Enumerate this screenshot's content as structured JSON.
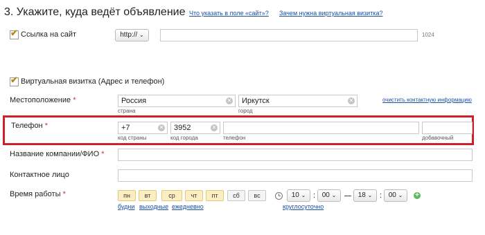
{
  "header": {
    "title": "3. Укажите, куда ведёт объявление",
    "help1": "Что указать в поле «сайт»?",
    "help2": "Зачем нужна виртуальная визитка?"
  },
  "site": {
    "label": "Ссылка на сайт",
    "protocol": "http://",
    "url_value": "",
    "counter": "1024"
  },
  "vcard": {
    "label": "Виртуальная визитка (Адрес и телефон)"
  },
  "location": {
    "label": "Местоположение",
    "country_value": "Россия",
    "country_hint": "страна",
    "city_value": "Иркутск",
    "city_hint": "город",
    "clear_link": "очистить контактную информацию"
  },
  "phone": {
    "label": "Телефон",
    "country_code": "+7",
    "country_code_hint": "код страны",
    "city_code": "3952",
    "city_code_hint": "код города",
    "number": "",
    "number_hint": "телефон",
    "ext": "",
    "ext_hint": "добавочный"
  },
  "company": {
    "label": "Название компании/ФИО",
    "value": ""
  },
  "contact": {
    "label": "Контактное лицо",
    "value": ""
  },
  "schedule": {
    "label": "Время работы",
    "days": [
      "пн",
      "вт",
      "ср",
      "чт",
      "пт",
      "сб",
      "вс"
    ],
    "days_selected": [
      true,
      true,
      true,
      true,
      true,
      false,
      false
    ],
    "links": [
      "будни",
      "выходные",
      "ежедневно"
    ],
    "from_hour": "10",
    "from_min": "00",
    "to_hour": "18",
    "to_min": "00",
    "around_clock": "круглосуточно"
  },
  "colors": {
    "required": "#d42a2a",
    "highlight": "#cf1f2b",
    "link": "#1a4fa8"
  },
  "icons": {
    "checkbox": "checkmark-icon",
    "clear": "clear-icon",
    "clock": "clock-icon",
    "add": "add-icon"
  }
}
